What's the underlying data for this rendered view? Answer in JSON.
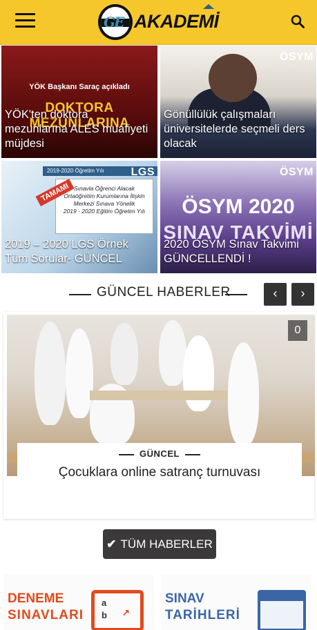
{
  "header": {
    "logo_text": "AKADEMİ",
    "logo_mark": "GE",
    "menu_icon": "hamburger-icon",
    "search_icon": "search-icon",
    "brand_color": "#f6c72b"
  },
  "featured": [
    {
      "title": "YÖK'ten doktora mezunlarına ALES muafiyeti müjdesi",
      "image_small": "YÖK Başkanı Saraç açıkladı",
      "image_big": "DOKTORA MEZUNLARINA",
      "tag": ""
    },
    {
      "title": "Gönüllülük çalışmaları üniversitelerde seçmeli ders olacak",
      "tag": "ÖSYM"
    },
    {
      "title": "2019 – 2020 LGS Örnek Tüm Sorular- GÜNCEL",
      "tag": "LGS",
      "image_header": "2019-2020 Öğretim Yılı",
      "image_ribbon": "TAMAMI",
      "image_lines": [
        "Sınavla Öğrenci Alacak",
        "Ortaöğretim Kurumlarına İlişkin",
        "Merkezi Sınava Yönelik",
        "2019 - 2020 Eğitim Öğretim Yılı"
      ]
    },
    {
      "title": "2020 ÖSYM Sınav Takvimi GÜNCELLENDİ !",
      "tag": "ÖSYM",
      "image_big": "ÖSYM 2020",
      "image_sub": "SINAV TAKVİMİ"
    }
  ],
  "section": {
    "title": "GÜNCEL HABERLER",
    "prev_icon": "chevron-left-icon",
    "next_icon": "chevron-right-icon"
  },
  "news": {
    "comment_count": "0",
    "category": "GÜNCEL",
    "title": "Çocuklara online satranç turnuvası"
  },
  "all_news": {
    "icon": "check-icon",
    "label": "TÜM HABERLER"
  },
  "promos": [
    {
      "line1": "DENEME",
      "line2": "SINAVLARI",
      "icon": "quiz-icon",
      "color": "#e24a1d"
    },
    {
      "line1": "SINAV",
      "line2": "TARİHLERİ",
      "icon": "calendar-icon",
      "color": "#3a66a6"
    }
  ]
}
